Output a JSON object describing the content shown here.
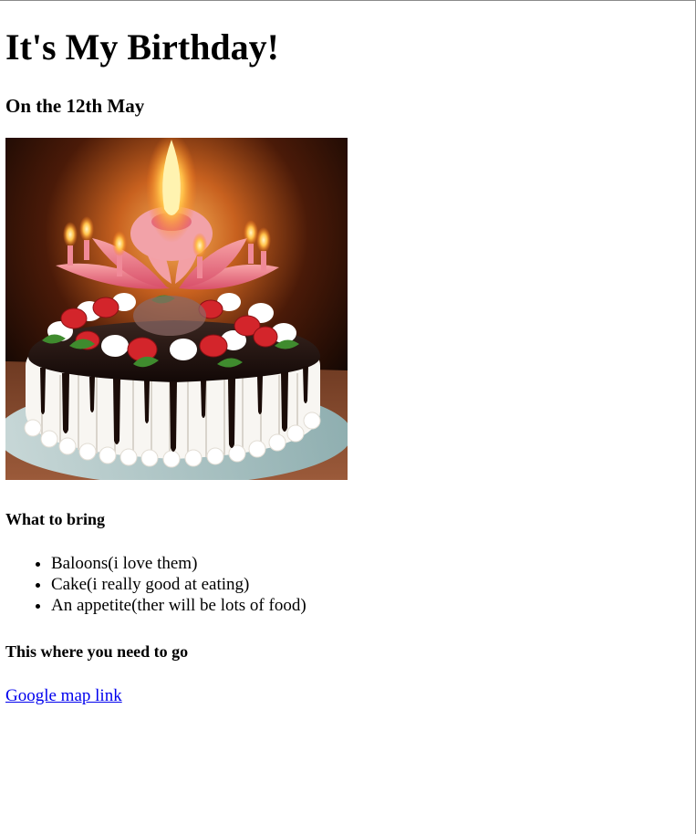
{
  "page": {
    "title": "It's My Birthday!",
    "date_heading": "On the 12th May",
    "bring_heading": "What to bring",
    "bring_items": [
      "Baloons(i love them)",
      "Cake(i really good at eating)",
      "An appetite(ther will be lots of food)"
    ],
    "location_heading": "This where you need to go",
    "map_link_text": "Google map link"
  },
  "image": {
    "icon": "birthday-cake-with-candles-photo"
  },
  "colors": {
    "link": "#0000ee",
    "text": "#000000",
    "background": "#ffffff"
  }
}
